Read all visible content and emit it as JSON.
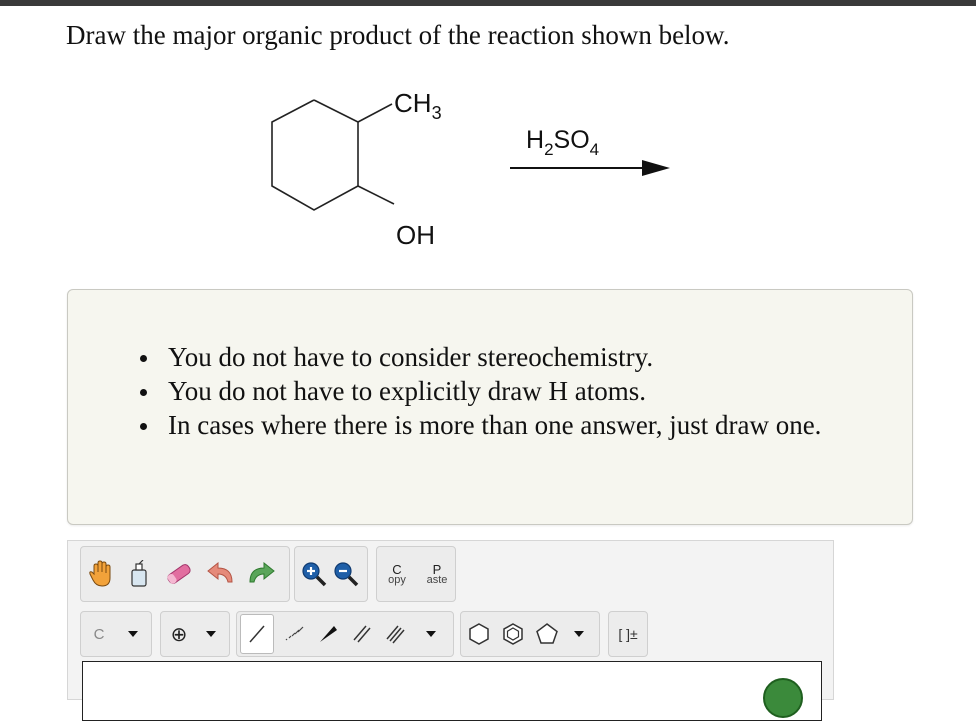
{
  "question": "Draw the major organic product of the reaction shown below.",
  "reaction": {
    "substituent_top": "CH3",
    "substituent_bottom": "OH",
    "reagent": "H2SO4"
  },
  "hints": [
    "You do not have to consider stereochemistry.",
    "You do not have to explicitly draw H atoms.",
    "In cases where there is more than one answer, just draw one."
  ],
  "toolbar": {
    "copy_label_top": "C",
    "copy_label_bottom": "opy",
    "paste_label_top": "P",
    "paste_label_bottom": "aste",
    "atom_selector": "C",
    "charge_symbol": "⊕",
    "bracket_label": "[ ]±"
  },
  "colors": {
    "hint_background": "#f6f6ef",
    "editor_background": "#f3f3f3",
    "zoom_icon_blue": "#1f5fa8",
    "redo_green": "#5aa55a",
    "undo_salmon": "#e58a7a",
    "eraser_pink": "#e26ea0"
  }
}
